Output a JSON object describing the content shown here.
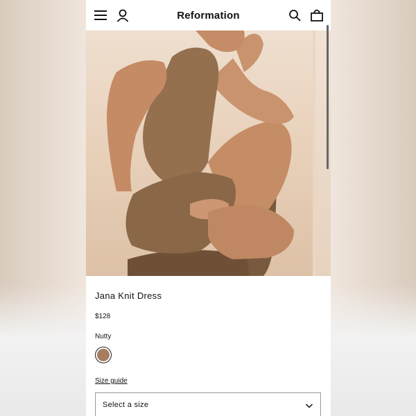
{
  "header": {
    "brand": "Reformation",
    "icons": [
      "menu-icon",
      "account-icon",
      "search-icon",
      "bag-icon"
    ]
  },
  "gallery": {
    "current_image": "product-photo",
    "has_next_peek": true
  },
  "product": {
    "name": "Jana Knit Dress",
    "price": "$128",
    "color_name": "Nutty",
    "swatch_color": "#a67e5f"
  },
  "size": {
    "guide_label": "Size guide",
    "select_placeholder": "Select a size"
  },
  "colors": {
    "dress": "#94704f",
    "skin": "#c9936e",
    "boots": "#7a5a3e",
    "backdrop": "#ecdac8"
  }
}
